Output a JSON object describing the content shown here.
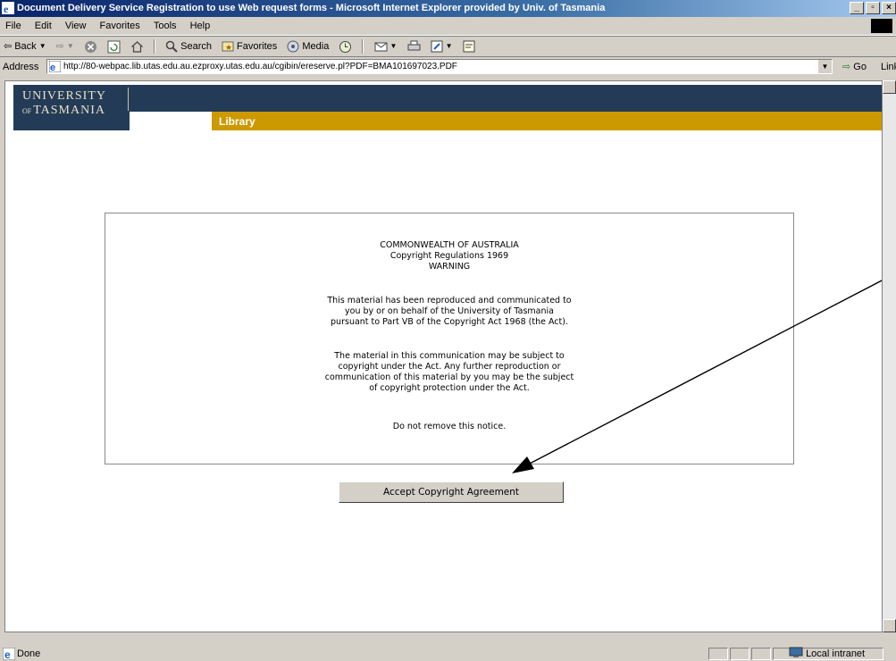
{
  "window": {
    "title": "Document Delivery Service Registration to use Web request forms - Microsoft Internet Explorer provided by Univ. of Tasmania"
  },
  "menu": {
    "items": [
      "File",
      "Edit",
      "View",
      "Favorites",
      "Tools",
      "Help"
    ]
  },
  "toolbar": {
    "back": "Back",
    "search": "Search",
    "favorites": "Favorites",
    "media": "Media"
  },
  "address": {
    "label": "Address",
    "url": "http://80-webpac.lib.utas.edu.au.ezproxy.utas.edu.au/cgibin/ereserve.pl?PDF=BMA101697023.PDF",
    "go": "Go",
    "links": "Link"
  },
  "header": {
    "logo_line1": "UNIVERSITY",
    "logo_of": "OF",
    "logo_line2": "TASMANIA",
    "section": "Library"
  },
  "notice": {
    "lines1": [
      "COMMONWEALTH OF AUSTRALIA",
      "Copyright Regulations 1969",
      "WARNING"
    ],
    "lines2": [
      "This material has been reproduced and communicated to",
      "you by or on behalf of the University of Tasmania",
      "pursuant to Part VB of the Copyright Act 1968 (the Act)."
    ],
    "lines3": [
      "The material in this communication may be subject to",
      "copyright under the Act. Any further reproduction or",
      "communication of this material by you may be the subject",
      "of copyright protection under the Act."
    ],
    "lines4": [
      "Do not remove this notice."
    ]
  },
  "accept_button": "Accept Copyright Agreement",
  "status": {
    "text": "Done",
    "zone": "Local intranet"
  }
}
